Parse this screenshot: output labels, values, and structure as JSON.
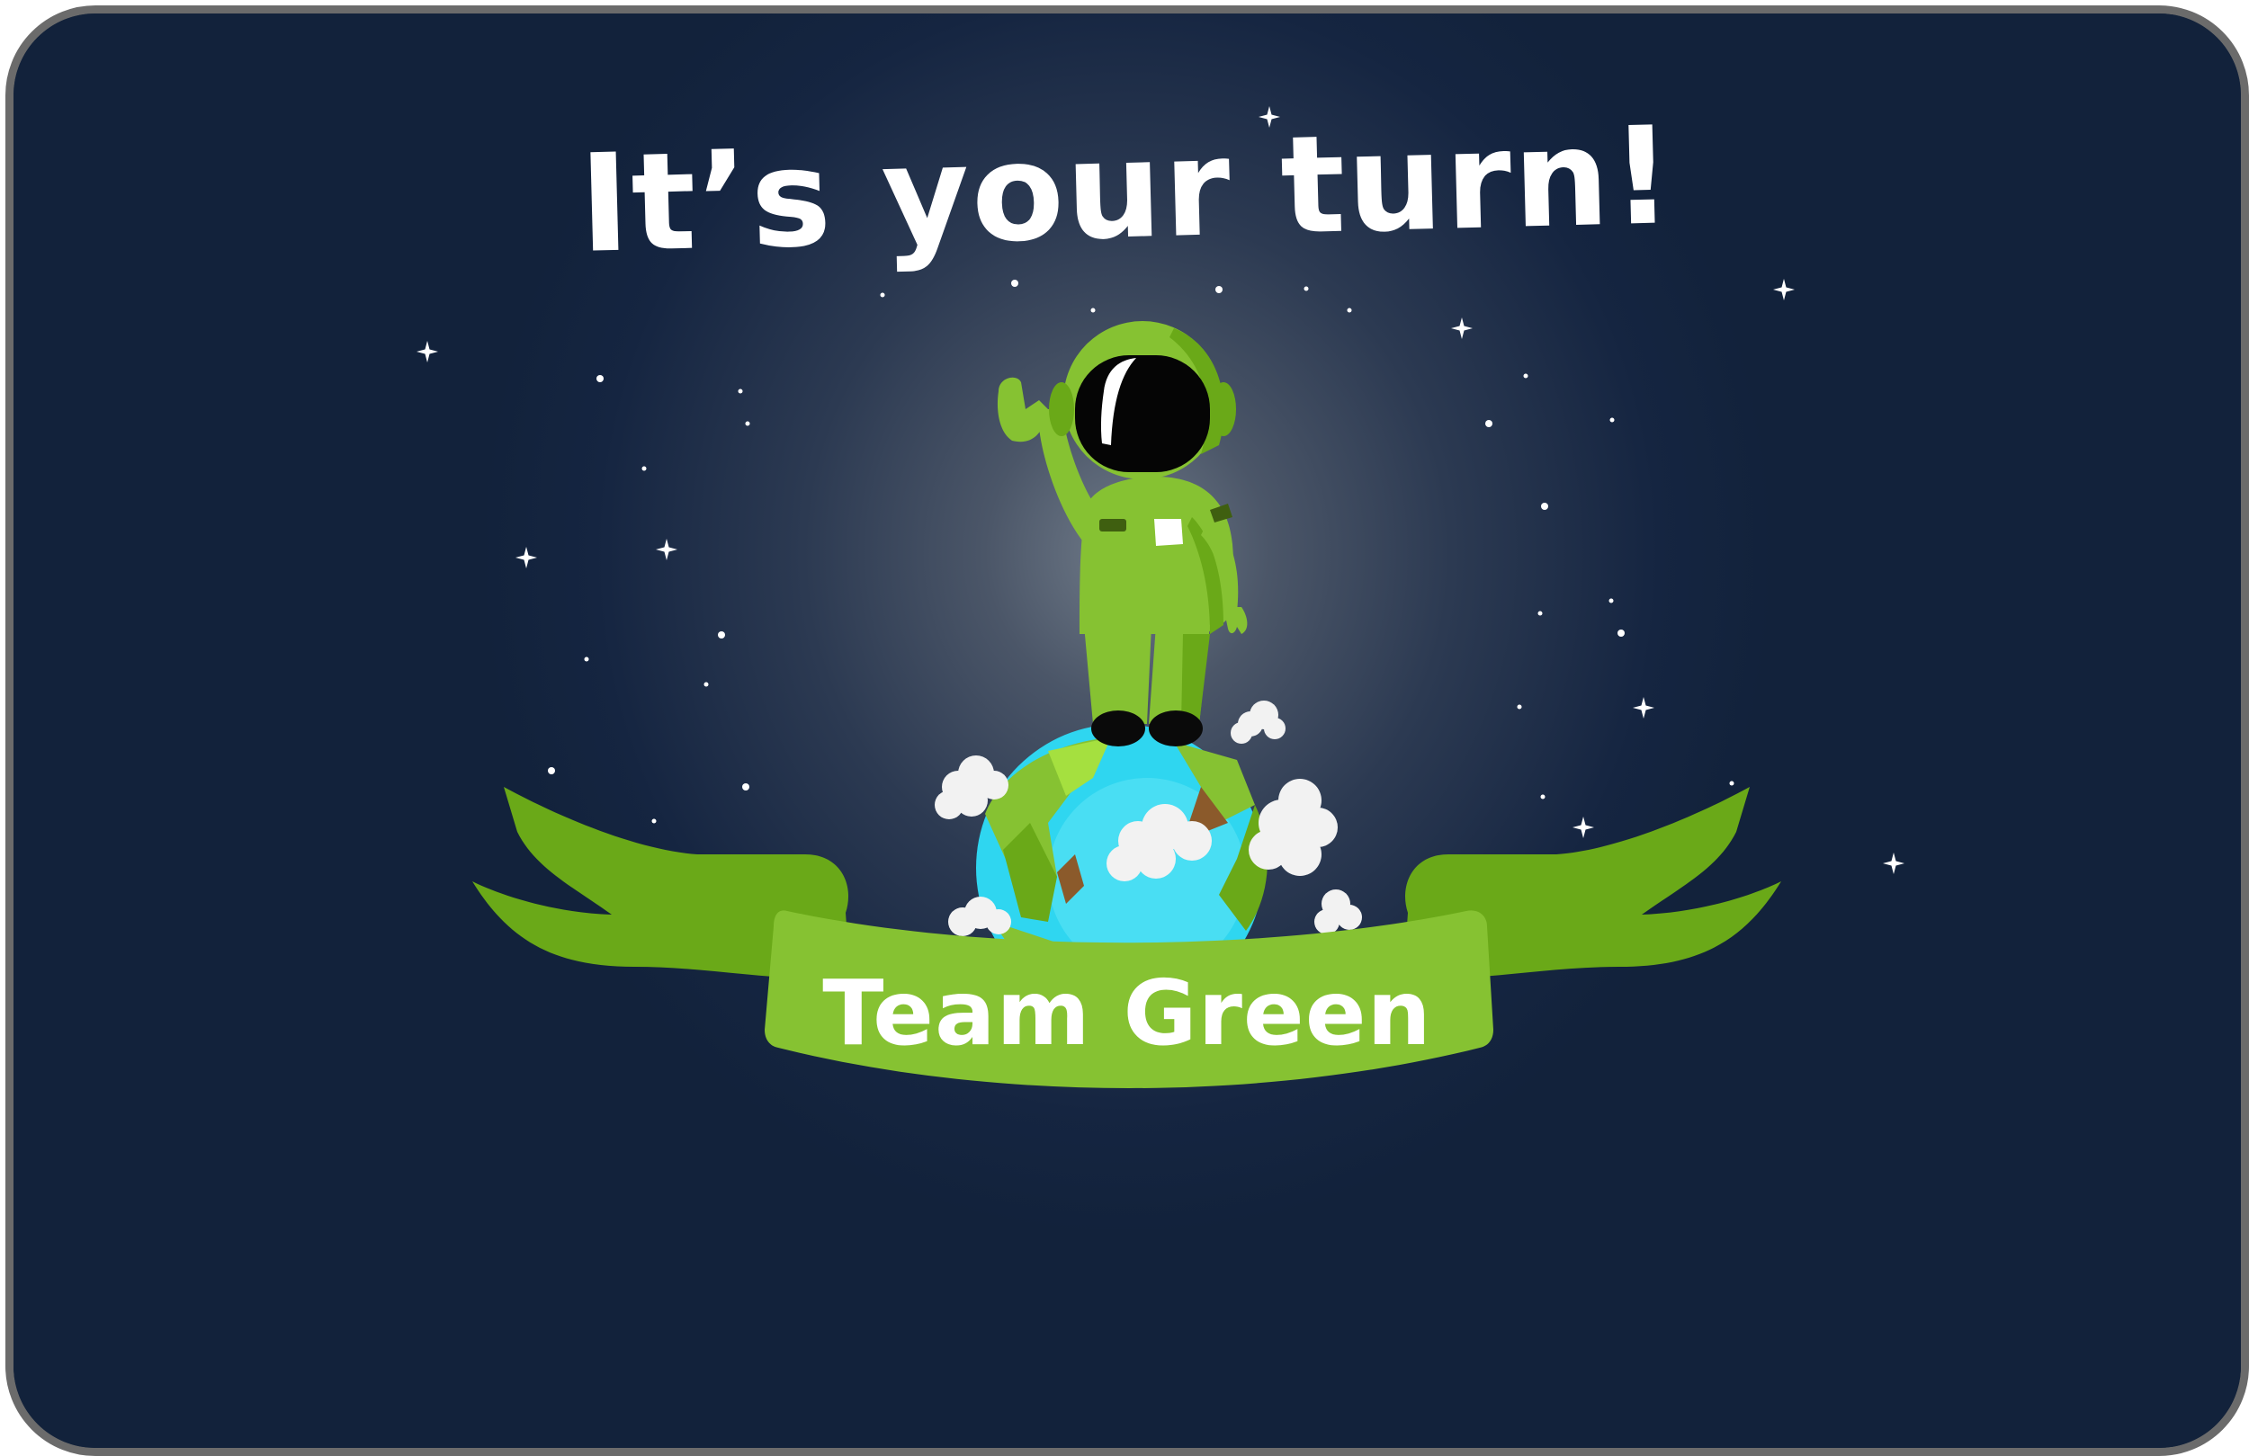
{
  "screen": {
    "title": "It’s your turn!",
    "team_name": "Team Green"
  },
  "colors": {
    "background": "#12223b",
    "frame": "#6b6b6b",
    "team_green": "#86c232",
    "team_green_dark": "#6aa918",
    "planet_water": "#2fd6f0",
    "title_text": "#ffffff"
  },
  "icons": [
    "astronaut-icon",
    "planet-icon",
    "cloud-icon",
    "star-icon",
    "ribbon-banner"
  ]
}
